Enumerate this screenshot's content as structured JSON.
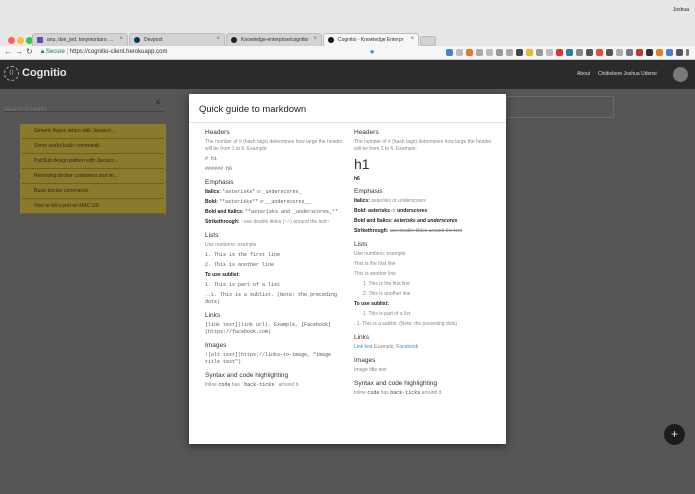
{
  "browser": {
    "tabs": [
      {
        "label": "anu, don_jed, tonymontaro, ..."
      },
      {
        "label": "Devpost"
      },
      {
        "label": "Knowledge-enterprise/cognitio"
      },
      {
        "label": "Cognitio - Knowledge Enterpr"
      }
    ],
    "user_chip": "Joshua",
    "secure_label": "Secure",
    "url": "https://cognitio-client.herokuapp.com"
  },
  "app": {
    "logo": "Cognitio",
    "about": "About",
    "username": "Chidiebere Joshua Udensi"
  },
  "sidebar": {
    "search_placeholder": "Search Cognitio",
    "close": "x",
    "notes": [
      "Generic Async return with Javascri...",
      "Some useful bash commands",
      "PubSub design pattern with Javascr...",
      "Removing docker containers and im...",
      "Basic docker commands",
      "How to kill a port on MAC OS"
    ]
  },
  "fab": "+",
  "modal": {
    "title": "Quick guide to markdown",
    "left": {
      "headers_title": "Headers",
      "headers_desc": "The number of # (hash tags) determines how large the header will be from 1 to 6. Example:",
      "h1_code": "# h1",
      "h6_code": "###### h6",
      "emphasis_title": "Emphasis",
      "italics_label": "Italics:",
      "italics_code": "*asterisks*",
      "italics_or": "or",
      "italics_code2": "_underscores_",
      "bold_label": "Bold:",
      "bold_code": "**asterisks**",
      "bold_or": "or",
      "bold_code2": "__underscores__",
      "bolditalic_label": "Bold and Italics:",
      "bolditalic_code": "**asterisks and _underscores_**",
      "strike_label": "Strikethrough:",
      "strike_text": "~use double tildes (~~) around the text~",
      "lists_title": "Lists",
      "lists_desc": "Use numbers: example",
      "list_1": "1. This is the first line",
      "list_2": "2. This is another line",
      "sublist_label": "To use sublist:",
      "sublist_1": "1. This is part of a list",
      "sublist_2": "..1. This is a sublist. (Note: the preceding dots)",
      "links_title": "Links",
      "links_code": "[link text](link url). Example, [Facebook](https://facebook.com)",
      "images_title": "Images",
      "images_code": "![alt text](https://links-to-image, \"image title text\")",
      "syntax_title": "Syntax and code highlighting",
      "syntax_desc_pre": "Inline",
      "syntax_desc_code": "code",
      "syntax_desc_mid": "has",
      "syntax_desc_code2": "`back-ticks`",
      "syntax_desc_post": "around it."
    },
    "right": {
      "headers_title": "Headers",
      "headers_desc": "The number of # (hash tags) determines how large the header will be from 1 to 6. Example:",
      "h1": "h1",
      "h6": "h6",
      "emphasis_title": "Emphasis",
      "italics_label": "Italics:",
      "italics_text": "asterisks or underscores",
      "bold_label": "Bold:",
      "bold_text": "asterisks",
      "bold_or": "or",
      "bold_text2": "underscores",
      "bolditalic_label": "Bold and Italics:",
      "bolditalic_text": "asterisks and underscores",
      "strike_label": "Strikethrough:",
      "strike_text": "use double tildes around the text",
      "lists_title": "Lists",
      "lists_desc": "Use numbers: example",
      "list_1": "This is the first line",
      "list_2": "This is another line",
      "list_o1": "1. This is the first line",
      "list_o2": "2. This is another line",
      "sublist_label": "To use sublist:",
      "sublist_1": "1. This is part of a list",
      "sublist_2": "..1. This is a sublist. (Note: the preceding dots)",
      "links_title": "Links",
      "link_text": "Link text",
      "link_example": "Example,",
      "link_fb": "Facebook",
      "images_title": "Images",
      "images_text": "Image title text",
      "syntax_title": "Syntax and code highlighting",
      "syntax_pre": "Inline",
      "syntax_code": "code",
      "syntax_mid": "has",
      "syntax_code2": "back-ticks",
      "syntax_post": "around it."
    }
  }
}
